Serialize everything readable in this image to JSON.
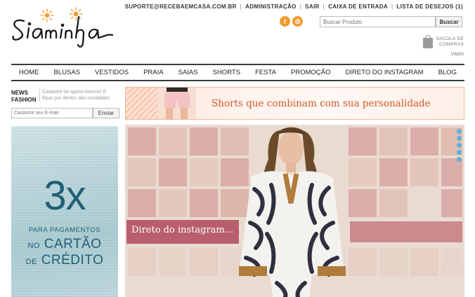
{
  "brand": {
    "logo_text": "Siaminha"
  },
  "top_links": [
    {
      "label": "SUPORTE@RECEBAEMCASA.COM.BR"
    },
    {
      "label": "ADMINISTRAÇÃO"
    },
    {
      "label": "SAIR"
    },
    {
      "label": "CAIXA DE ENTRADA"
    },
    {
      "label": "LISTA DE DESEJOS (1)"
    }
  ],
  "social": {
    "facebook_glyph": "f",
    "instagram_glyph": "◎"
  },
  "search": {
    "placeholder": "Buscar Produto",
    "button_label": "Buscar"
  },
  "cart": {
    "label_line1": "SACOLA DE",
    "label_line2": "COMPRAS",
    "status": "Vazio"
  },
  "nav": {
    "items": [
      {
        "label": "HOME"
      },
      {
        "label": "BLUSAS"
      },
      {
        "label": "VESTIDOS"
      },
      {
        "label": "PRAIA"
      },
      {
        "label": "SAIAS"
      },
      {
        "label": "SHORTS"
      },
      {
        "label": "FESTA"
      },
      {
        "label": "PROMOÇÃO"
      },
      {
        "label": "DIRETO DO INSTAGRAM"
      },
      {
        "label": "BLOG"
      }
    ]
  },
  "newsletter": {
    "title_line1": "NEWS",
    "title_line2": "FASHION",
    "description": "Cadastre-se agora mesmo! E fique por dentro das novidades",
    "placeholder": "Cadastre seu E-mail",
    "button_label": "Enviar"
  },
  "promo": {
    "big": "3x",
    "line1": "PARA PAGAMENTOS",
    "line2_a": "NO",
    "line2_b": "CARTÃO",
    "line3_a": "DE",
    "line3_b": "CRÉDITO"
  },
  "banners": {
    "shorts_text": "Shorts que combinam com sua personalidade",
    "instagram_text": "Direto do instagram..."
  },
  "colors": {
    "accent_orange": "#f29a2f",
    "promo_blue": "#1f5f78",
    "banner_text": "#d55a2c",
    "slider_dot": "#4fb0d8"
  },
  "icons": [
    "facebook-icon",
    "instagram-icon",
    "shopping-bag-icon",
    "sun-flower-icon"
  ]
}
